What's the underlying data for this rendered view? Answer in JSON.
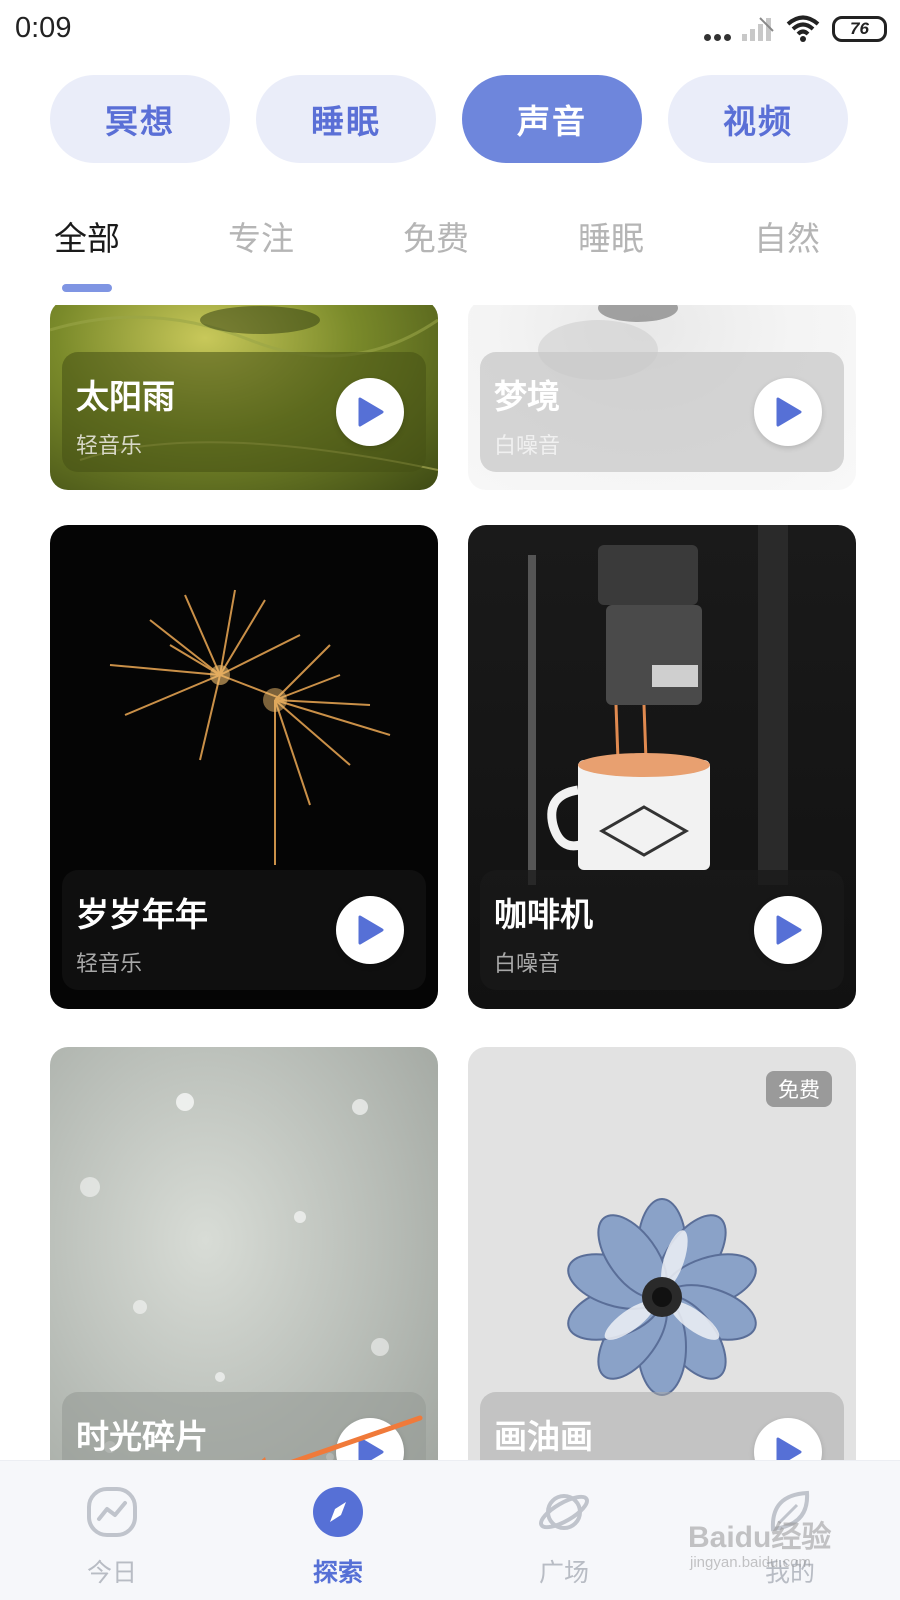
{
  "status_bar": {
    "time": "0:09",
    "battery": "76",
    "icons": [
      "more-dots-icon",
      "signal-icon",
      "wifi-icon",
      "battery-icon"
    ]
  },
  "categories": [
    {
      "label": "冥想",
      "active": false
    },
    {
      "label": "睡眠",
      "active": false
    },
    {
      "label": "声音",
      "active": true
    },
    {
      "label": "视频",
      "active": false
    }
  ],
  "tabs": [
    {
      "label": "全部",
      "active": true
    },
    {
      "label": "专注",
      "active": false
    },
    {
      "label": "免费",
      "active": false
    },
    {
      "label": "睡眠",
      "active": false
    },
    {
      "label": "自然",
      "active": false
    }
  ],
  "cards": [
    {
      "title": "太阳雨",
      "subtitle": "轻音乐",
      "free_badge": ""
    },
    {
      "title": "梦境",
      "subtitle": "白噪音",
      "free_badge": ""
    },
    {
      "title": "岁岁年年",
      "subtitle": "轻音乐",
      "free_badge": ""
    },
    {
      "title": "咖啡机",
      "subtitle": "白噪音",
      "free_badge": ""
    },
    {
      "title": "时光碎片",
      "subtitle": "",
      "free_badge": ""
    },
    {
      "title": "画油画",
      "subtitle": "",
      "free_badge": "免费"
    }
  ],
  "bottom_nav": [
    {
      "label": "今日",
      "icon": "trend-icon",
      "active": false
    },
    {
      "label": "探索",
      "icon": "compass-icon",
      "active": true
    },
    {
      "label": "广场",
      "icon": "planet-icon",
      "active": false
    },
    {
      "label": "我的",
      "icon": "leaf-icon",
      "active": false
    }
  ],
  "watermark": {
    "brand": "Baidu经验",
    "url": "jingyan.baidu.com"
  },
  "colors": {
    "accent": "#6e86dc",
    "pill_bg": "#eaedf9",
    "pill_text": "#5a6fd6",
    "nav_active": "#5670d6",
    "arrow": "#f07a3a"
  }
}
